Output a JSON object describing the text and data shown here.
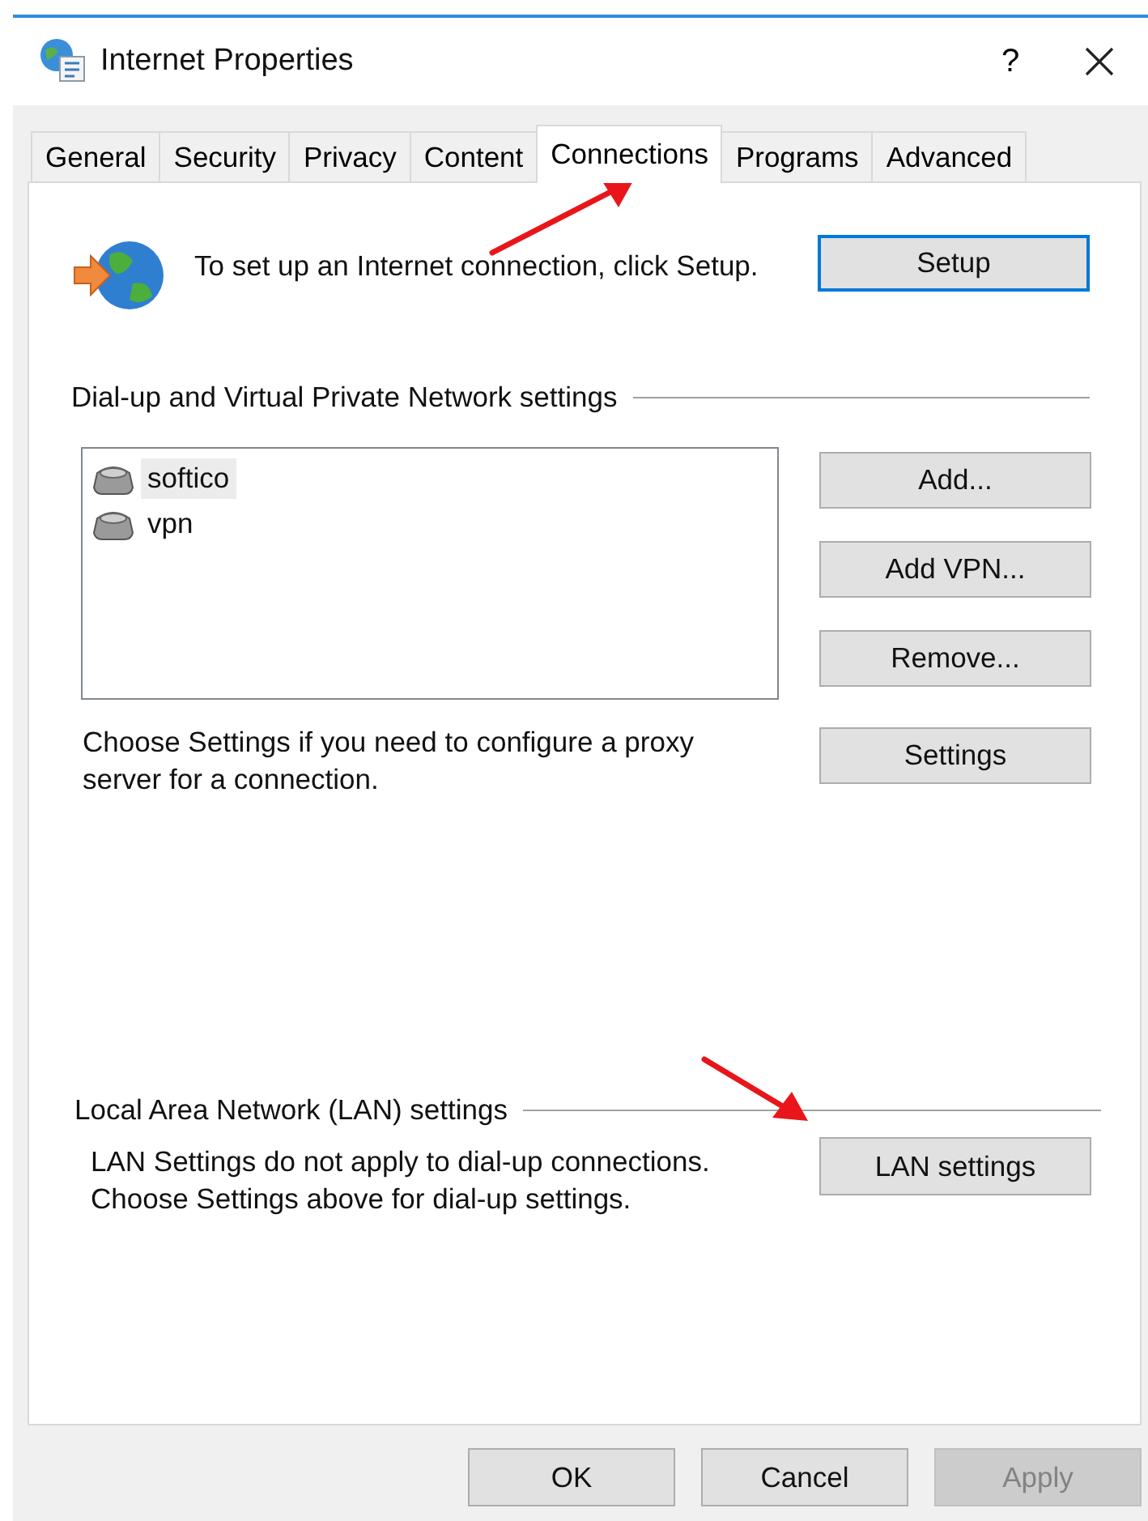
{
  "window": {
    "title": "Internet Properties",
    "help": "?"
  },
  "tabs": [
    {
      "label": "General",
      "selected": false
    },
    {
      "label": "Security",
      "selected": false
    },
    {
      "label": "Privacy",
      "selected": false
    },
    {
      "label": "Content",
      "selected": false
    },
    {
      "label": "Connections",
      "selected": true
    },
    {
      "label": "Programs",
      "selected": false
    },
    {
      "label": "Advanced",
      "selected": false
    }
  ],
  "setup": {
    "text": "To set up an Internet connection, click Setup.",
    "button": {
      "label": "Setup",
      "focused": true
    }
  },
  "dialup": {
    "heading": "Dial-up and Virtual Private Network settings",
    "connections": [
      {
        "name": "softico",
        "selected": true
      },
      {
        "name": "vpn",
        "selected": false
      }
    ],
    "buttons": [
      {
        "label": "Add...",
        "disabled": false
      },
      {
        "label": "Add VPN...",
        "disabled": false
      },
      {
        "label": "Remove...",
        "disabled": false
      }
    ],
    "proxy_text": "Choose Settings if you need to configure a proxy server for a connection.",
    "settings_button": "Settings"
  },
  "lan": {
    "heading": "Local Area Network (LAN) settings",
    "text": "LAN Settings do not apply to dial-up connections. Choose Settings above for dial-up settings.",
    "button": "LAN settings"
  },
  "footer_buttons": [
    {
      "label": "OK",
      "disabled": false
    },
    {
      "label": "Cancel",
      "disabled": false
    },
    {
      "label": "Apply",
      "disabled": true
    }
  ]
}
